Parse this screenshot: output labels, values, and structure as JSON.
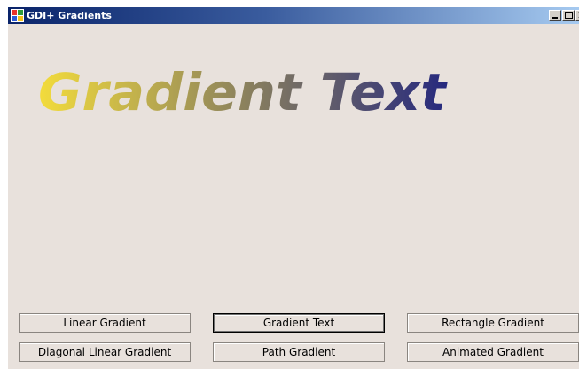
{
  "window": {
    "title": "GDI+ Gradients",
    "icon": "windows-app-icon",
    "controls": {
      "minimize": "minimize-icon",
      "maximize": "maximize-icon",
      "close": "close-icon"
    }
  },
  "canvas": {
    "text": "Gradient Text",
    "gradient_start_color": "#f3dc3c",
    "gradient_end_color": "#25287e",
    "background_color": "#e8e1dc"
  },
  "buttons": {
    "linear_gradient": "Linear Gradient",
    "gradient_text": "Gradient Text",
    "rectangle_gradient": "Rectangle Gradient",
    "diagonal_linear_gradient": "Diagonal Linear Gradient",
    "path_gradient": "Path Gradient",
    "animated_gradient": "Animated Gradient"
  },
  "colors": {
    "titlebar_start": "#0a246a",
    "titlebar_end": "#a6caf0",
    "form_background": "#e8e1dc"
  }
}
